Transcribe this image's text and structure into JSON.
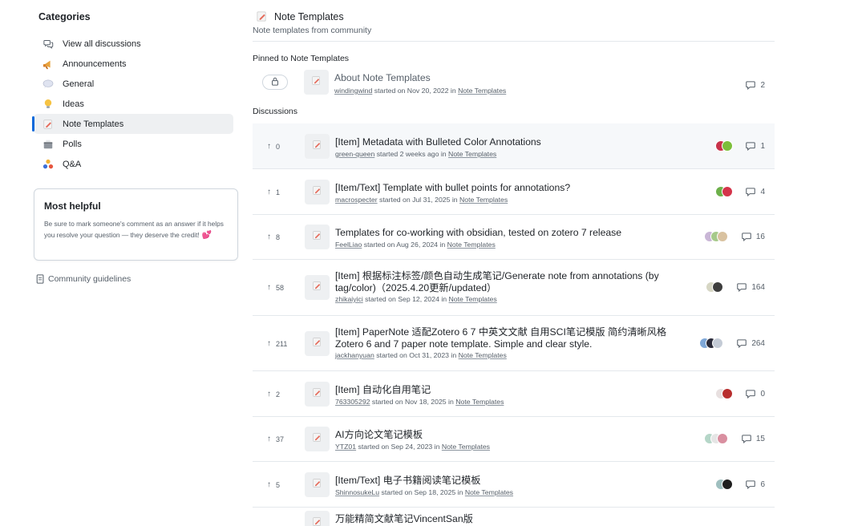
{
  "sidebar": {
    "categories_title": "Categories",
    "items": [
      {
        "label": "View all discussions",
        "icon": "discussions-icon"
      },
      {
        "label": "Announcements",
        "icon": "megaphone-icon"
      },
      {
        "label": "General",
        "icon": "speech-bubble-icon"
      },
      {
        "label": "Ideas",
        "icon": "lightbulb-icon"
      },
      {
        "label": "Note Templates",
        "icon": "memo-icon"
      },
      {
        "label": "Polls",
        "icon": "ballot-icon"
      },
      {
        "label": "Q&A",
        "icon": "people-icon"
      }
    ],
    "active_index": 4,
    "helpful": {
      "title": "Most helpful",
      "text": "Be sure to mark someone's comment as an answer if it helps you resolve your question — they deserve the credit!",
      "heart": "💕"
    },
    "guidelines": "Community guidelines"
  },
  "header": {
    "title": "Note Templates",
    "description": "Note templates from community"
  },
  "pinned": {
    "label": "Pinned to Note Templates",
    "item": {
      "title": "About Note Templates",
      "author": "windingwind",
      "started": " started on Nov 20, 2022 in ",
      "category": "Note Templates",
      "comments": "2"
    }
  },
  "discussions": {
    "label": "Discussions",
    "items": [
      {
        "votes": "0",
        "title": "[Item] Metadata with Bulleted Color Annotations",
        "title2": "",
        "author": "green-queen",
        "started": " started 2 weeks ago in ",
        "category": "Note Templates",
        "comments": "1",
        "avatars": [
          "#c8334a",
          "#7cbf3a"
        ]
      },
      {
        "votes": "1",
        "title": "[Item/Text] Template with bullet points for annotations?",
        "title2": "",
        "author": "macrospecter",
        "started": " started on Jul 31, 2025 in ",
        "category": "Note Templates",
        "comments": "4",
        "avatars": [
          "#6db04a",
          "#d4344a"
        ]
      },
      {
        "votes": "8",
        "title": "Templates for co-working with obsidian, tested on zotero 7 release",
        "title2": "",
        "author": "FeelLiao",
        "started": " started on Aug 26, 2024 in ",
        "category": "Note Templates",
        "comments": "16",
        "avatars": [
          "#c9b6d6",
          "#a6c98a",
          "#d9c2a0"
        ]
      },
      {
        "votes": "58",
        "title": "[Item] 根据标注标签/颜色自动生成笔记/Generate note from annotations (by",
        "title2": "tag/color)（2025.4.20更新/updated）",
        "author": "zhikaiyici",
        "started": " started on Sep 12, 2024 in ",
        "category": "Note Templates",
        "comments": "164",
        "avatars": [
          "#d6d6c4",
          "#3d3d3d"
        ]
      },
      {
        "votes": "211",
        "title": "[Item] PaperNote 适配Zotero 6 7 中英文文献 自用SCI笔记模版 简约清晰风格",
        "title2": "Zotero 6 and 7 paper note template. Simple and clear style.",
        "author": "jackhanyuan",
        "started": " started on Oct 31, 2023 in ",
        "category": "Note Templates",
        "comments": "264",
        "avatars": [
          "#7fa8d8",
          "#2b2b3a",
          "#c4cbd6"
        ]
      },
      {
        "votes": "2",
        "title": "[Item] 自动化自用笔记",
        "title2": "",
        "author": "763305292",
        "started": " started on Nov 18, 2025 in ",
        "category": "Note Templates",
        "comments": "0",
        "avatars": [
          "#e8e0e0",
          "#b82e2e"
        ]
      },
      {
        "votes": "37",
        "title": "AI方向论文笔记模板",
        "title2": "",
        "author": "YTZ01",
        "started": " started on Sep 24, 2023 in ",
        "category": "Note Templates",
        "comments": "15",
        "avatars": [
          "#b5d6c8",
          "#e5e5e5",
          "#d98fa0"
        ]
      },
      {
        "votes": "5",
        "title": "[Item/Text] 电子书籍阅读笔记模板",
        "title2": "",
        "author": "ShinnosukeLu",
        "started": " started on Sep 18, 2025 in ",
        "category": "Note Templates",
        "comments": "6",
        "avatars": [
          "#9fbfbf",
          "#1e1e1e"
        ]
      },
      {
        "votes": "",
        "title": "万能精简文献笔记VincentSan版",
        "title2": "",
        "author": "",
        "started": "",
        "category": "",
        "comments": "",
        "avatars": []
      }
    ]
  }
}
